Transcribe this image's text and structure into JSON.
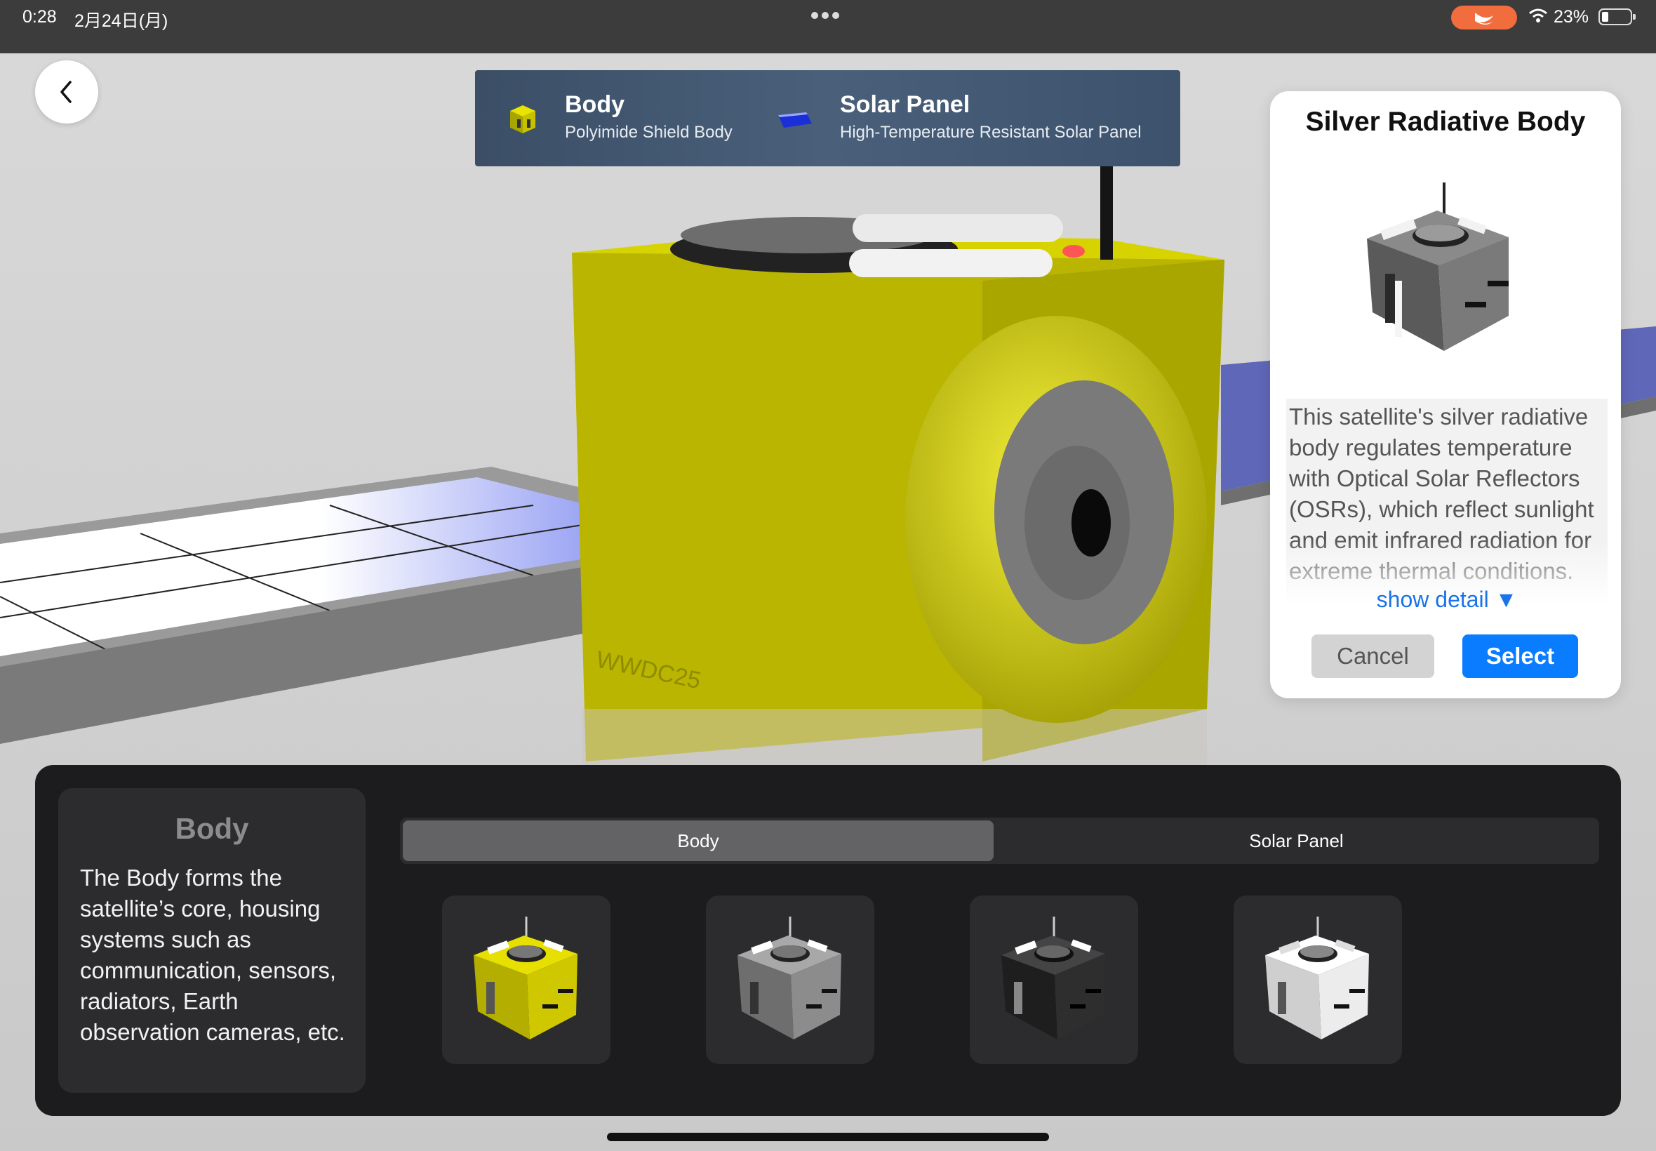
{
  "status_bar": {
    "time": "0:28",
    "date": "2月24日(月)",
    "battery_percent": "23%",
    "battery_level": 0.23
  },
  "banner": {
    "parts": [
      {
        "title": "Body",
        "subtitle": "Polyimide Shield Body",
        "icon": "yellow-cube-icon"
      },
      {
        "title": "Solar Panel",
        "subtitle": "High-Temperature Resistant Solar Panel",
        "icon": "solar-panel-icon"
      }
    ]
  },
  "scene": {
    "logo_text": "WWDC25",
    "body_color": "#c9c60a",
    "panel_color": "#7a86f0"
  },
  "detail_card": {
    "title": "Silver Radiative Body",
    "description": "This satellite's silver radiative body regulates temperature with Optical Solar Reflectors (OSRs), which reflect sunlight and emit infrared radiation for extreme thermal conditions.",
    "show_detail_label": "show detail ▼",
    "cancel_label": "Cancel",
    "select_label": "Select"
  },
  "bottom_panel": {
    "info_title": "Body",
    "info_description": "The Body forms the satellite’s core, housing systems such as communication, sensors, radiators, Earth observation cameras, etc.",
    "tabs": [
      {
        "label": "Body",
        "selected": true
      },
      {
        "label": "Solar Panel",
        "selected": false
      }
    ],
    "options": [
      {
        "name": "yellow-body-option",
        "color": "#d8d000"
      },
      {
        "name": "silver-body-option",
        "color": "#9a9a9a"
      },
      {
        "name": "black-body-option",
        "color": "#2e2e2e"
      },
      {
        "name": "white-body-option",
        "color": "#f2f2f2"
      }
    ]
  },
  "colors": {
    "accent": "#0a7cff",
    "swift_badge": "#f26d3d"
  }
}
